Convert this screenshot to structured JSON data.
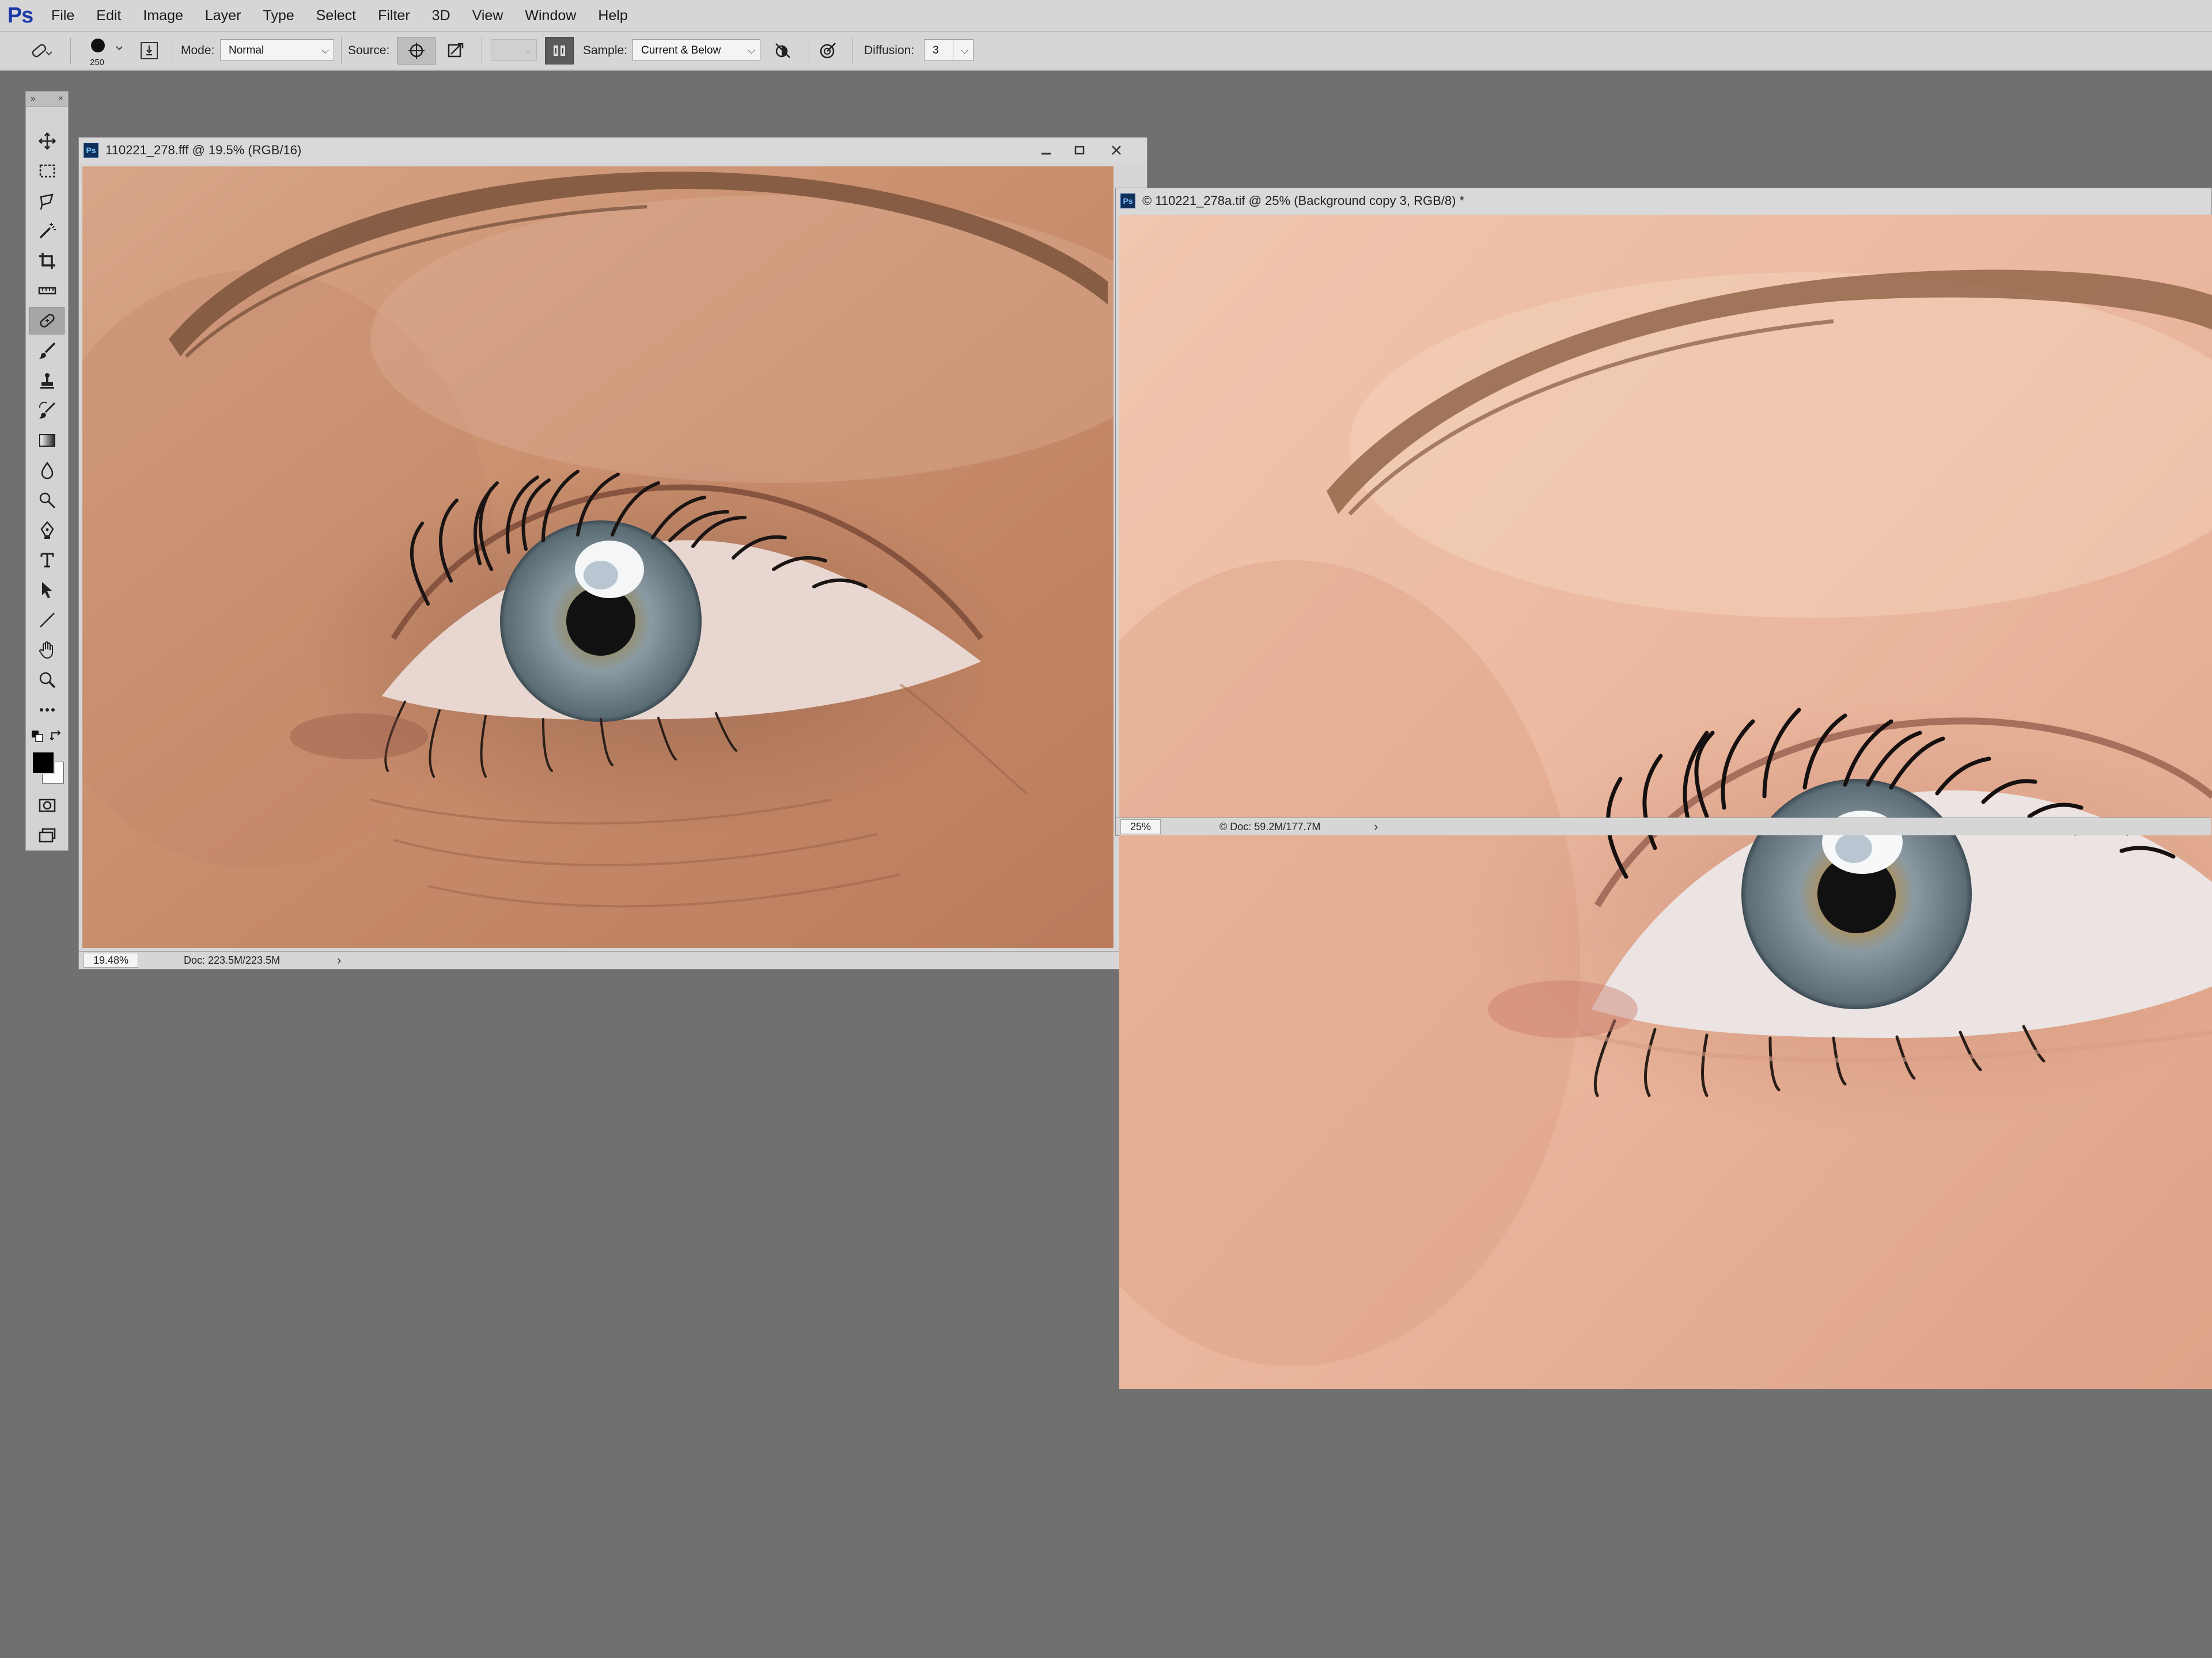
{
  "app": {
    "logo": "Ps",
    "menus": [
      {
        "label": "File"
      },
      {
        "label": "Edit"
      },
      {
        "label": "Image"
      },
      {
        "label": "Layer"
      },
      {
        "label": "Type"
      },
      {
        "label": "Select"
      },
      {
        "label": "Filter"
      },
      {
        "label": "3D"
      },
      {
        "label": "View"
      },
      {
        "label": "Window"
      },
      {
        "label": "Help"
      }
    ]
  },
  "options": {
    "brush_size": "250",
    "mode_label": "Mode:",
    "mode_value": "Normal",
    "source_label": "Source:",
    "sample_label": "Sample:",
    "sample_value": "Current & Below",
    "diffusion_label": "Diffusion:",
    "diffusion_value": "3"
  },
  "tools": {
    "selected": "spot-healing-brush",
    "items": [
      "move-icon",
      "marquee-icon",
      "lasso-icon",
      "magic-wand-icon",
      "crop-icon",
      "ruler-icon",
      "healing-brush-icon",
      "brush-icon",
      "clone-stamp-icon",
      "history-brush-icon",
      "gradient-icon",
      "blur-icon",
      "dodge-icon",
      "pen-icon",
      "type-icon",
      "path-selection-icon",
      "line-icon",
      "hand-icon",
      "zoom-icon",
      "more-tools-icon"
    ],
    "foreground_color": "#000000",
    "background_color": "#ffffff"
  },
  "doc1": {
    "title": "110221_278.fff @ 19.5% (RGB/16)",
    "zoom": "19.48%",
    "info": "Doc: 223.5M/223.5M"
  },
  "doc2": {
    "title": "© 110221_278a.tif @ 25% (Background copy 3, RGB/8) *",
    "zoom": "25%",
    "info": "© Doc: 59.2M/177.7M"
  },
  "colors": {
    "workspace": "#707070",
    "panel": "#d6d6d6",
    "accent": "#1e3aa8"
  }
}
